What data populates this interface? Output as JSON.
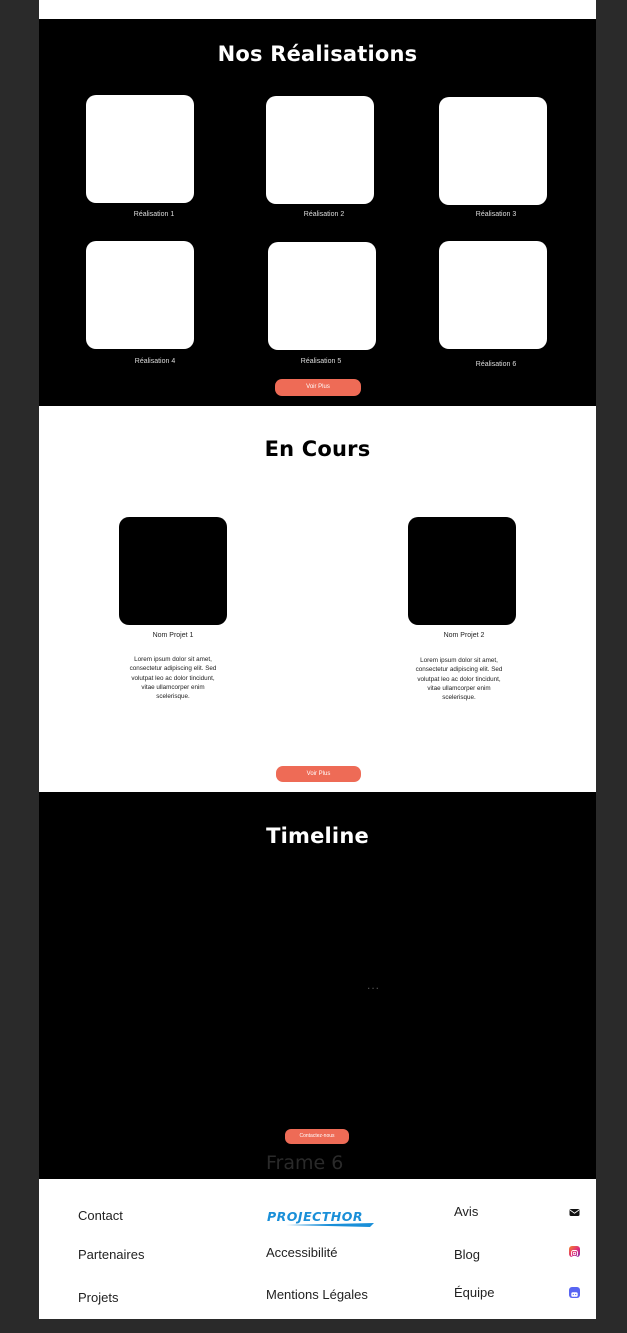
{
  "realisations": {
    "title": "Nos Réalisations",
    "items": [
      {
        "label": "Réalisation 1"
      },
      {
        "label": "Réalisation 2"
      },
      {
        "label": "Réalisation 3"
      },
      {
        "label": "Réalisation 4"
      },
      {
        "label": "Réalisation 5"
      },
      {
        "label": "Réalisation 6"
      }
    ],
    "more_label": "Voir Plus"
  },
  "en_cours": {
    "title": "En Cours",
    "projects": [
      {
        "name": "Nom Projet 1",
        "description": "Lorem ipsum dolor sit amet, consectetur adipiscing elit. Sed volutpat leo ac dolor tincidunt, vitae ullamcorper enim scelerisque."
      },
      {
        "name": "Nom Projet 2",
        "description": "Lorem ipsum dolor sit amet, consectetur adipiscing elit. Sed volutpat leo ac dolor tincidunt, vitae ullamcorper enim scelerisque."
      }
    ],
    "more_label": "Voir Plus"
  },
  "timeline": {
    "title": "Timeline",
    "dots": "...",
    "contact_label": "Contactez-nous",
    "frame_label": "Frame 6"
  },
  "footer": {
    "col1": [
      "Contact",
      "Partenaires",
      "Projets"
    ],
    "logo_text": "PROJECTHOR",
    "col2": [
      "Accessibilité",
      "Mentions Légales"
    ],
    "col3": [
      "Avis",
      "Blog",
      "Équipe"
    ],
    "icons": [
      "mail-icon",
      "instagram-icon",
      "discord-icon"
    ]
  },
  "colors": {
    "accent": "#ee6b56",
    "logo_blue": "#1a8fd8",
    "instagram": "#e1306c",
    "discord": "#5865f2"
  }
}
